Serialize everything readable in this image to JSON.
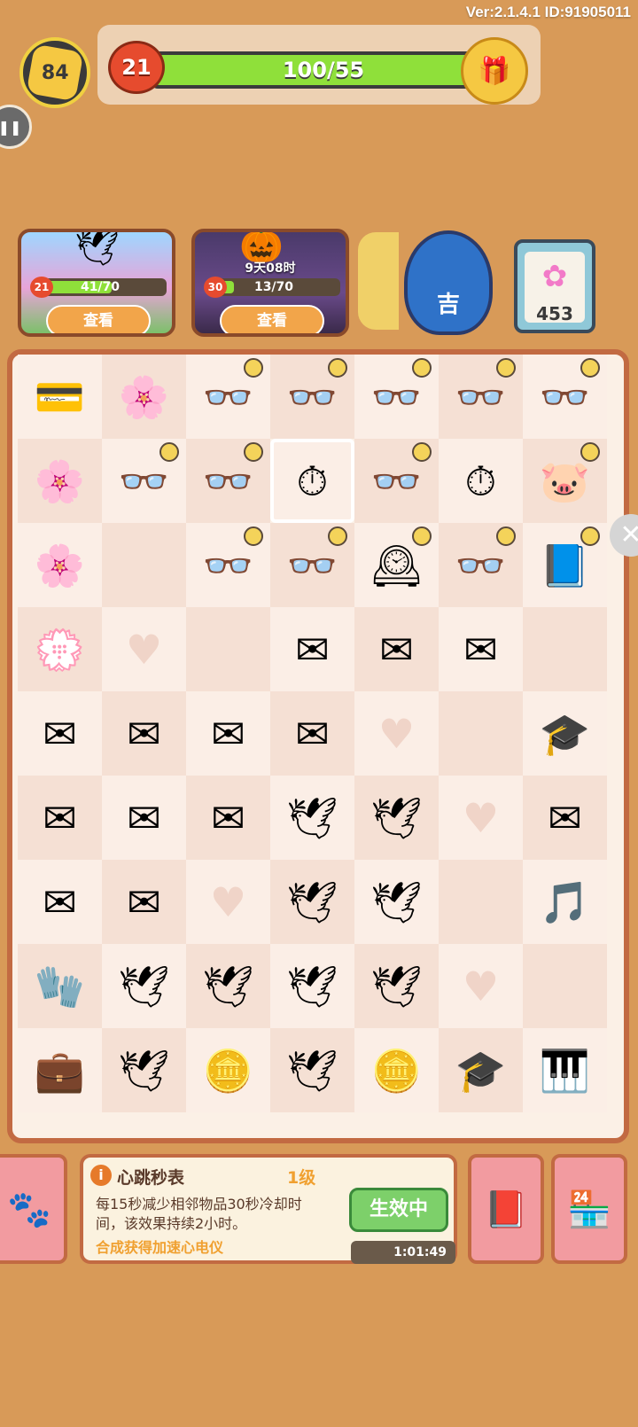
{
  "header": {
    "version": "Ver:2.1.4.1 ID:91905011",
    "player_level": "84",
    "energy_level": "21",
    "xp_text": "100/55",
    "xp_fraction": 1.0
  },
  "events": [
    {
      "progress_text": "41/70",
      "level": "21",
      "button": "查看",
      "icon": "paper-crane-icon"
    },
    {
      "progress_text": "13/70",
      "level": "30",
      "timer": "9天08时",
      "button": "查看",
      "icon": "pumpkin-witch-icon"
    }
  ],
  "collection": {
    "count": "453"
  },
  "daruma": {
    "label": "吉"
  },
  "grid": [
    [
      "wallet",
      "flower",
      "glasses",
      "glasses",
      "glasses",
      "glasses",
      "glasses"
    ],
    [
      "flowers",
      "glasses",
      "glasses",
      "watch",
      "glasses",
      "watch",
      "piggy"
    ],
    [
      "flower",
      "",
      "glasses",
      "glasses",
      "clock",
      "glasses",
      "book"
    ],
    [
      "flower-heart",
      "heart",
      "",
      "letter",
      "letter",
      "letter",
      ""
    ],
    [
      "letter",
      "letter",
      "letter",
      "letter",
      "heart",
      "",
      "grad-cap"
    ],
    [
      "letter",
      "letter",
      "letter",
      "crane",
      "crane",
      "heart",
      "letters"
    ],
    [
      "letter",
      "letter",
      "heart",
      "crane",
      "crane",
      "",
      "music"
    ],
    [
      "mittens",
      "crane",
      "crane",
      "crane",
      "crane",
      "heart",
      ""
    ],
    [
      "briefcase",
      "crane",
      "coins",
      "crane",
      "coin-stack",
      "grad-cap",
      "piano"
    ]
  ],
  "timers": [
    [
      0,
      0,
      1,
      1,
      1,
      1,
      1
    ],
    [
      0,
      1,
      1,
      0,
      1,
      0,
      1
    ],
    [
      0,
      0,
      1,
      1,
      1,
      1,
      1
    ],
    [
      0,
      0,
      0,
      0,
      0,
      0,
      0
    ],
    [
      0,
      0,
      0,
      0,
      0,
      0,
      0
    ],
    [
      0,
      0,
      0,
      0,
      0,
      0,
      0
    ],
    [
      0,
      0,
      0,
      0,
      0,
      0,
      0
    ],
    [
      0,
      0,
      0,
      0,
      0,
      0,
      0
    ],
    [
      0,
      0,
      0,
      0,
      0,
      0,
      0
    ]
  ],
  "icons": {
    "wallet": "💳",
    "flower": "🌸",
    "flowers": "🌸",
    "flower-heart": "💮",
    "glasses": "👓",
    "watch": "⏱",
    "piggy": "🐷",
    "clock": "🕰",
    "book": "📘",
    "letter": "✉",
    "letters": "✉",
    "grad-cap": "🎓",
    "crane": "🕊",
    "music": "🎵",
    "mittens": "🧤",
    "briefcase": "💼",
    "coins": "🪙",
    "coin-stack": "🪙",
    "piano": "🎹",
    "heart": "♥"
  },
  "info": {
    "name": "心跳秒表",
    "level": "1级",
    "description": "每15秒减少相邻物品30秒冷却时间，该效果持续2小时。",
    "hint": "合成获得加速心电仪",
    "button": "生效中",
    "countdown": "1:01:49"
  }
}
